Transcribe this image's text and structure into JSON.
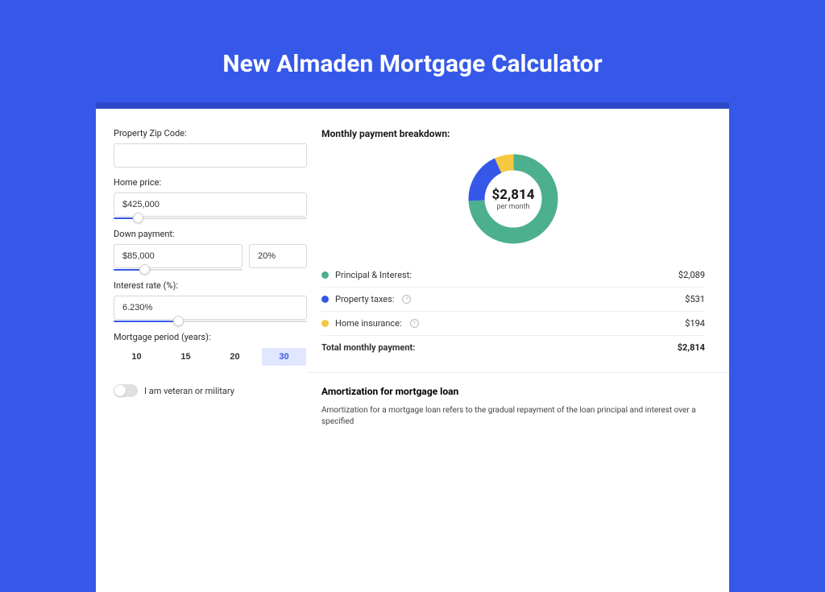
{
  "page_title": "New Almaden Mortgage Calculator",
  "form": {
    "zip_label": "Property Zip Code:",
    "zip_value": "",
    "home_price_label": "Home price:",
    "home_price_value": "$425,000",
    "home_price_slider_pct": 10,
    "down_payment_label": "Down payment:",
    "down_payment_value": "$85,000",
    "down_payment_pct_value": "20%",
    "down_payment_slider_pct": 20,
    "interest_label": "Interest rate (%):",
    "interest_value": "6.230%",
    "interest_slider_pct": 31,
    "period_label": "Mortgage period (years):",
    "periods": [
      "10",
      "15",
      "20",
      "30"
    ],
    "period_active": "30",
    "veteran_label": "I am veteran or military"
  },
  "breakdown": {
    "title": "Monthly payment breakdown:",
    "donut_amount": "$2,814",
    "donut_sub": "per month",
    "rows": [
      {
        "swatch": "sw-pi",
        "label": "Principal & Interest:",
        "info": false,
        "value": "$2,089"
      },
      {
        "swatch": "sw-tax",
        "label": "Property taxes:",
        "info": true,
        "value": "$531"
      },
      {
        "swatch": "sw-ins",
        "label": "Home insurance:",
        "info": true,
        "value": "$194"
      }
    ],
    "total_label": "Total monthly payment:",
    "total_value": "$2,814"
  },
  "amortization": {
    "title": "Amortization for mortgage loan",
    "text": "Amortization for a mortgage loan refers to the gradual repayment of the loan principal and interest over a specified"
  },
  "chart_data": {
    "type": "pie",
    "title": "Monthly payment breakdown",
    "series": [
      {
        "name": "Principal & Interest",
        "value": 2089,
        "color": "#4CAF8E"
      },
      {
        "name": "Property taxes",
        "value": 531,
        "color": "#3558E8"
      },
      {
        "name": "Home insurance",
        "value": 194,
        "color": "#F5C842"
      }
    ],
    "total": 2814
  }
}
